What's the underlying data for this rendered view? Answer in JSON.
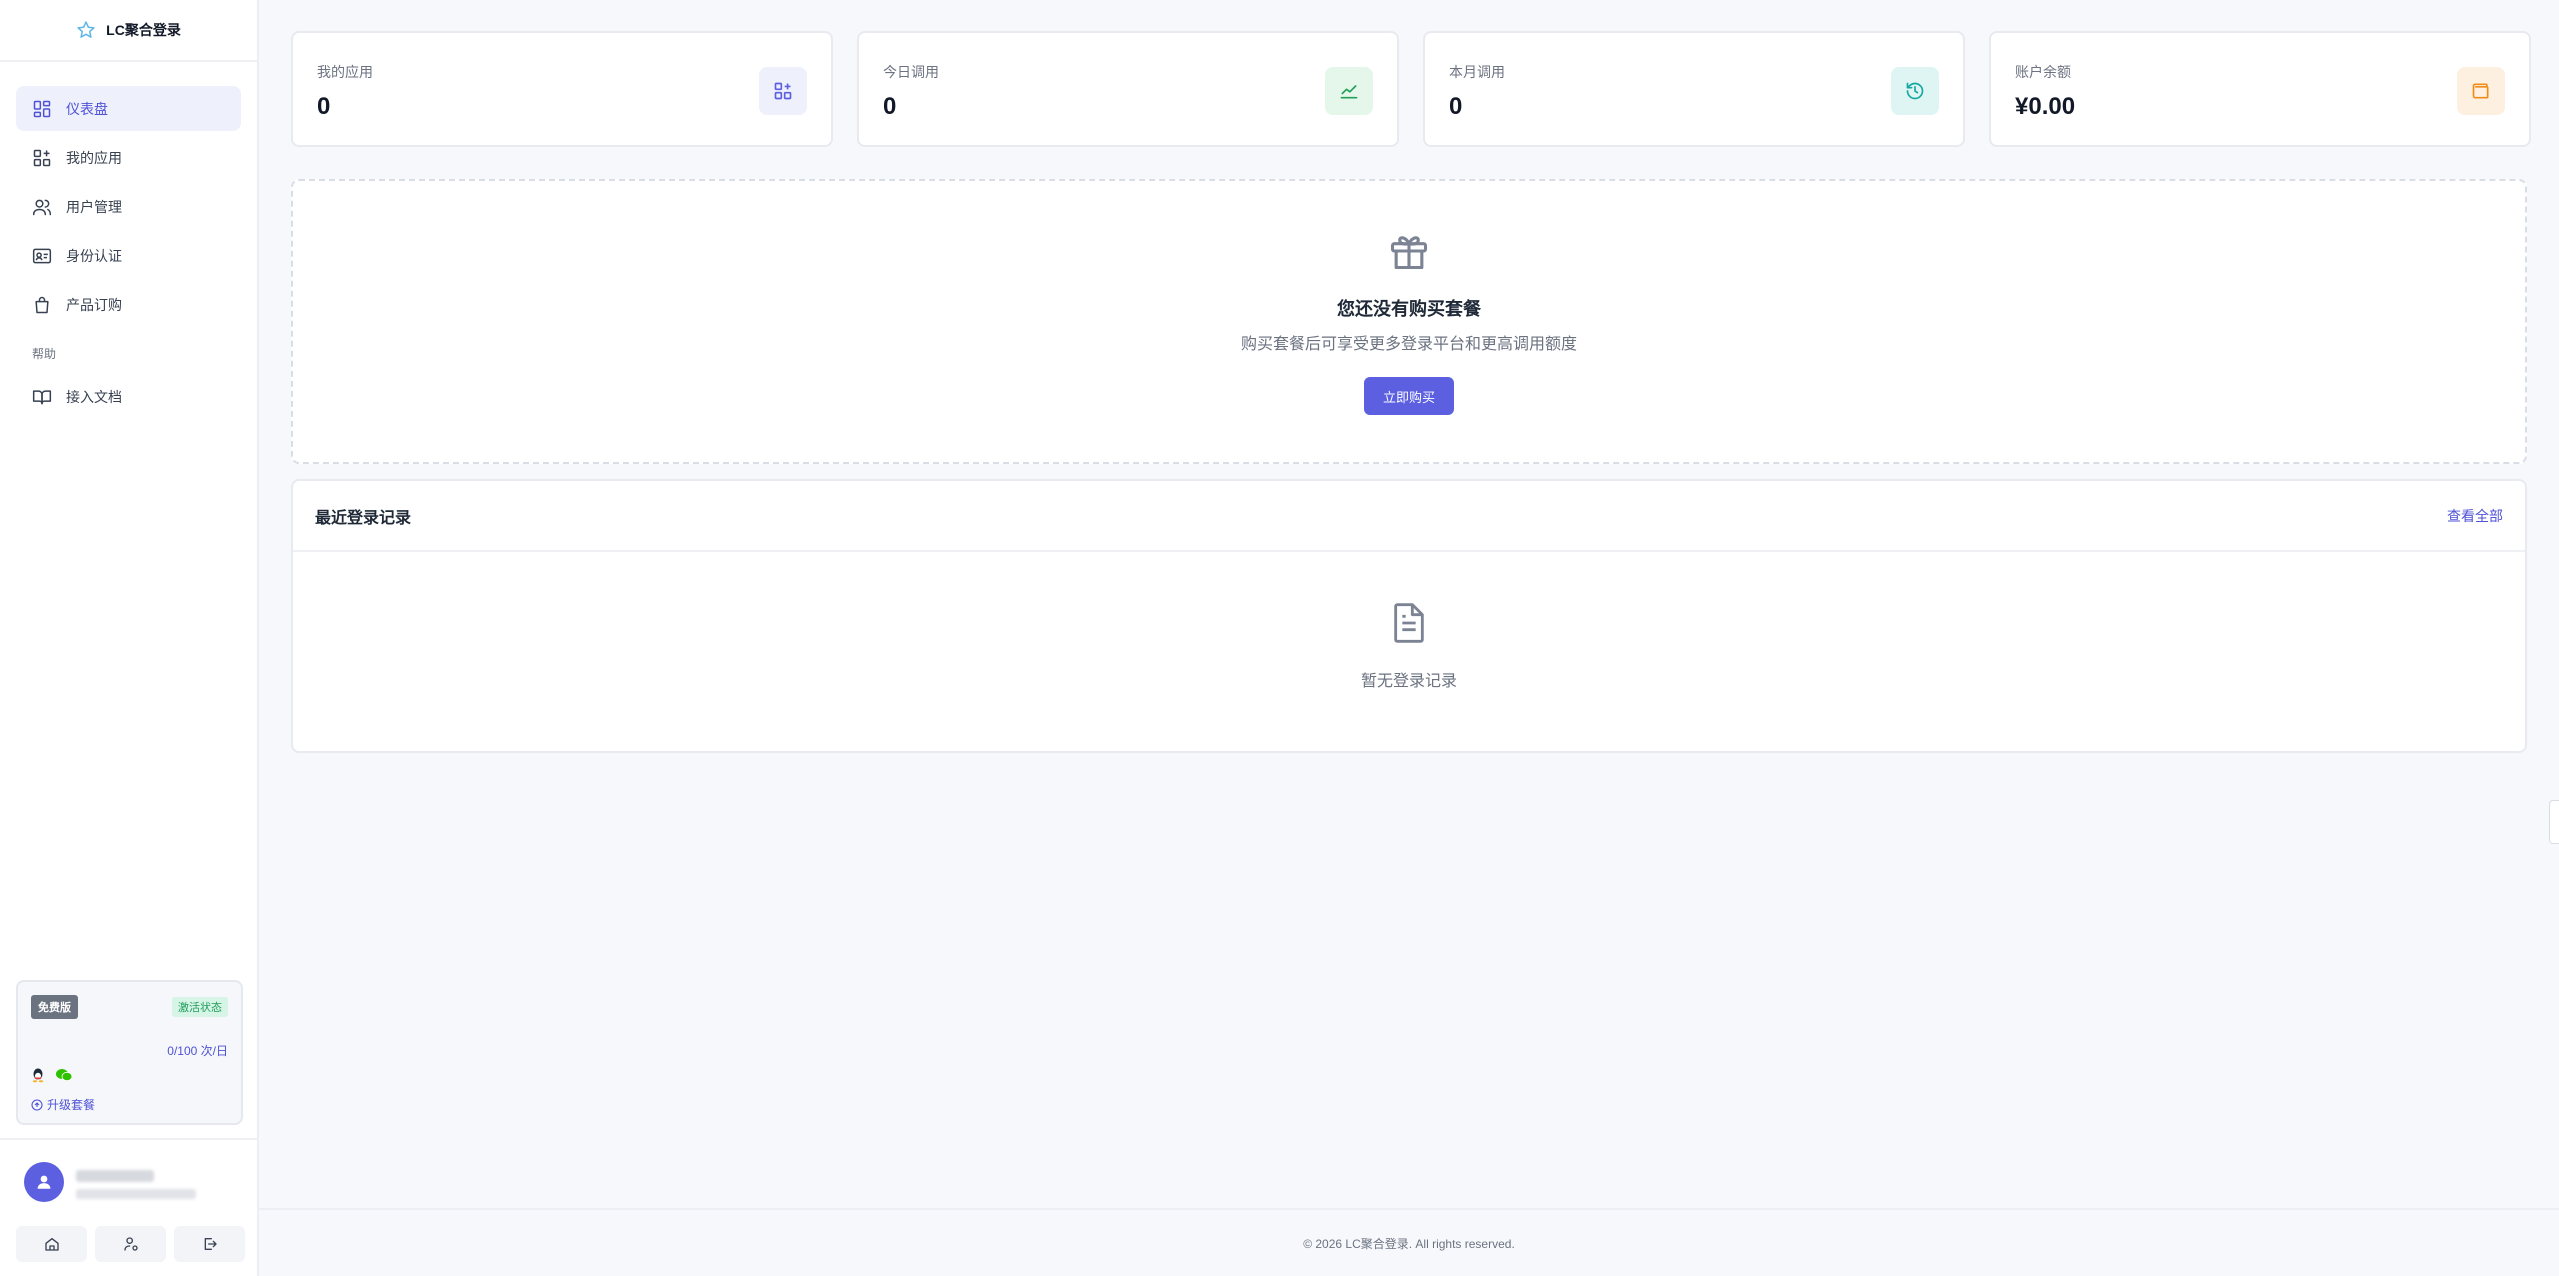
{
  "brand": {
    "name": "LC聚合登录",
    "logo_icon": "star-icon"
  },
  "sidebar": {
    "items": [
      {
        "label": "仪表盘",
        "icon": "dashboard-icon",
        "active": true
      },
      {
        "label": "我的应用",
        "icon": "apps-icon"
      },
      {
        "label": "用户管理",
        "icon": "users-icon"
      },
      {
        "label": "身份认证",
        "icon": "id-card-icon"
      },
      {
        "label": "产品订购",
        "icon": "shopping-bag-icon"
      }
    ],
    "help_section": "帮助",
    "help_items": [
      {
        "label": "接入文档",
        "icon": "book-icon"
      }
    ]
  },
  "plan": {
    "tier": "免费版",
    "status": "激活状态",
    "usage": "0/100 次/日",
    "upgrade": "升级套餐"
  },
  "stats": [
    {
      "label": "我的应用",
      "value": "0",
      "icon": "apps-add-icon",
      "color": "#5b5fe0",
      "bg": "#eef0fb"
    },
    {
      "label": "今日调用",
      "value": "0",
      "icon": "trend-chart-icon",
      "color": "#22a05b",
      "bg": "#e4f7ea"
    },
    {
      "label": "本月调用",
      "value": "0",
      "icon": "history-icon",
      "color": "#14a8a0",
      "bg": "#dff5f3"
    },
    {
      "label": "账户余额",
      "value": "¥0.00",
      "icon": "wallet-icon",
      "color": "#f08c1a",
      "bg": "#fdf0e0"
    }
  ],
  "promo": {
    "title": "您还没有购买套餐",
    "desc": "购买套餐后可享受更多登录平台和更高调用额度",
    "button": "立即购买"
  },
  "records": {
    "title": "最近登录记录",
    "view_all": "查看全部",
    "empty": "暂无登录记录"
  },
  "footer": {
    "text": "© 2026 LC聚合登录. All rights reserved."
  },
  "colors": {
    "accent": "#5b5fe0",
    "active_bg": "#eef0fb"
  }
}
